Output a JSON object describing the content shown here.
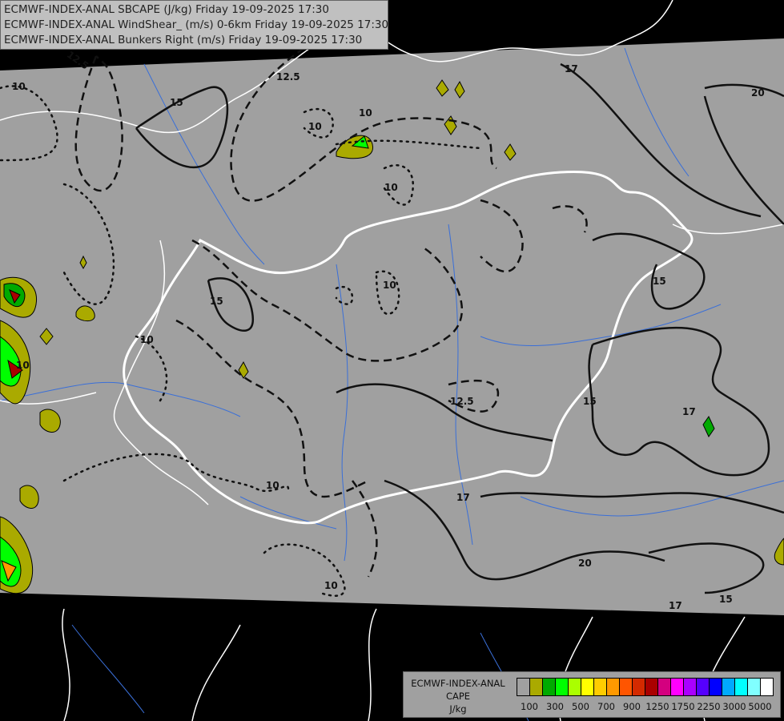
{
  "title_lines": [
    "ECMWF-INDEX-ANAL SBCAPE (J/kg) Friday 19-09-2025 17:30",
    "ECMWF-INDEX-ANAL WindShear_ (m/s) 0-6km Friday 19-09-2025 17:30",
    "ECMWF-INDEX-ANAL Bunkers Right (m/s) Friday 19-09-2025 17:30"
  ],
  "legend": {
    "line1": "ECMWF-INDEX-ANAL",
    "line2": "CAPE",
    "line3": "J/kg",
    "colors": [
      "#a0a0a0",
      "#aaaa00",
      "#00aa00",
      "#00ff00",
      "#aaff00",
      "#ffff00",
      "#ffcc00",
      "#ff9900",
      "#ff5500",
      "#d42a00",
      "#aa0000",
      "#d4007f",
      "#ff00ff",
      "#aa00ff",
      "#5500ff",
      "#0000ff",
      "#00aaff",
      "#00ffff",
      "#80ffff",
      "#ffffff"
    ],
    "tick_labels": [
      "100",
      "300",
      "500",
      "700",
      "900",
      "1250",
      "1750",
      "2250",
      "3000",
      "5000"
    ]
  },
  "contour_labels": [
    {
      "text": "12.5",
      "id": "a"
    },
    {
      "text": "10",
      "id": "b"
    },
    {
      "text": "15",
      "id": "c"
    },
    {
      "text": "12.5",
      "id": "d"
    },
    {
      "text": "10",
      "id": "e"
    },
    {
      "text": "10",
      "id": "f"
    },
    {
      "text": "17",
      "id": "g"
    },
    {
      "text": "20",
      "id": "h"
    },
    {
      "text": "10",
      "id": "i"
    },
    {
      "text": "15",
      "id": "j"
    },
    {
      "text": "10",
      "id": "k"
    },
    {
      "text": "12.5",
      "id": "l"
    },
    {
      "text": "15",
      "id": "m"
    },
    {
      "text": "17",
      "id": "n"
    },
    {
      "text": "10",
      "id": "o"
    },
    {
      "text": "17",
      "id": "p"
    },
    {
      "text": "10",
      "id": "q"
    },
    {
      "text": "20",
      "id": "r"
    },
    {
      "text": "17",
      "id": "s"
    },
    {
      "text": "15",
      "id": "t"
    },
    {
      "text": "15",
      "id": "u"
    },
    {
      "text": "10",
      "id": "v"
    },
    {
      "text": "10",
      "id": "w"
    }
  ]
}
